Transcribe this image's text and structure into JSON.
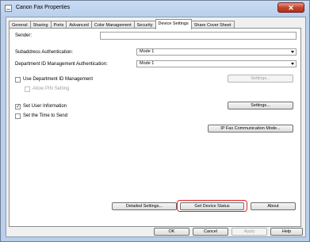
{
  "window": {
    "title": "Canon Fax Properties",
    "close_symbol": "✕"
  },
  "tabs": [
    {
      "label": "General"
    },
    {
      "label": "Sharing"
    },
    {
      "label": "Ports"
    },
    {
      "label": "Advanced"
    },
    {
      "label": "Color Management"
    },
    {
      "label": "Security"
    },
    {
      "label": "Device Settings"
    },
    {
      "label": "Share Cover Sheet"
    }
  ],
  "active_tab": "Device Settings",
  "sender": {
    "label": "Sender:",
    "value": ""
  },
  "subaddress_auth": {
    "label": "Subaddress Authentication:",
    "value": "Mode 1"
  },
  "dept_id_auth": {
    "label": "Department ID Management Authentication:",
    "value": "Mode 1"
  },
  "use_dept_id": {
    "label": "Use Department ID Management",
    "checked": false
  },
  "allow_pin": {
    "label": "Allow PIN Setting",
    "checked": false
  },
  "settings_dept_btn": "Settings...",
  "set_user_info": {
    "label": "Set User Information",
    "checked": true
  },
  "settings_user_btn": "Settings...",
  "set_time": {
    "label": "Set the Time to Send",
    "checked": false
  },
  "ip_fax_btn": "IP Fax Communication Mode...",
  "detailed_settings_btn": "Detailed Settings...",
  "get_device_status_btn": "Get Device Status",
  "about_btn": "About",
  "footer": {
    "ok": "OK",
    "cancel": "Cancel",
    "apply": "Apply",
    "help": "Help"
  }
}
